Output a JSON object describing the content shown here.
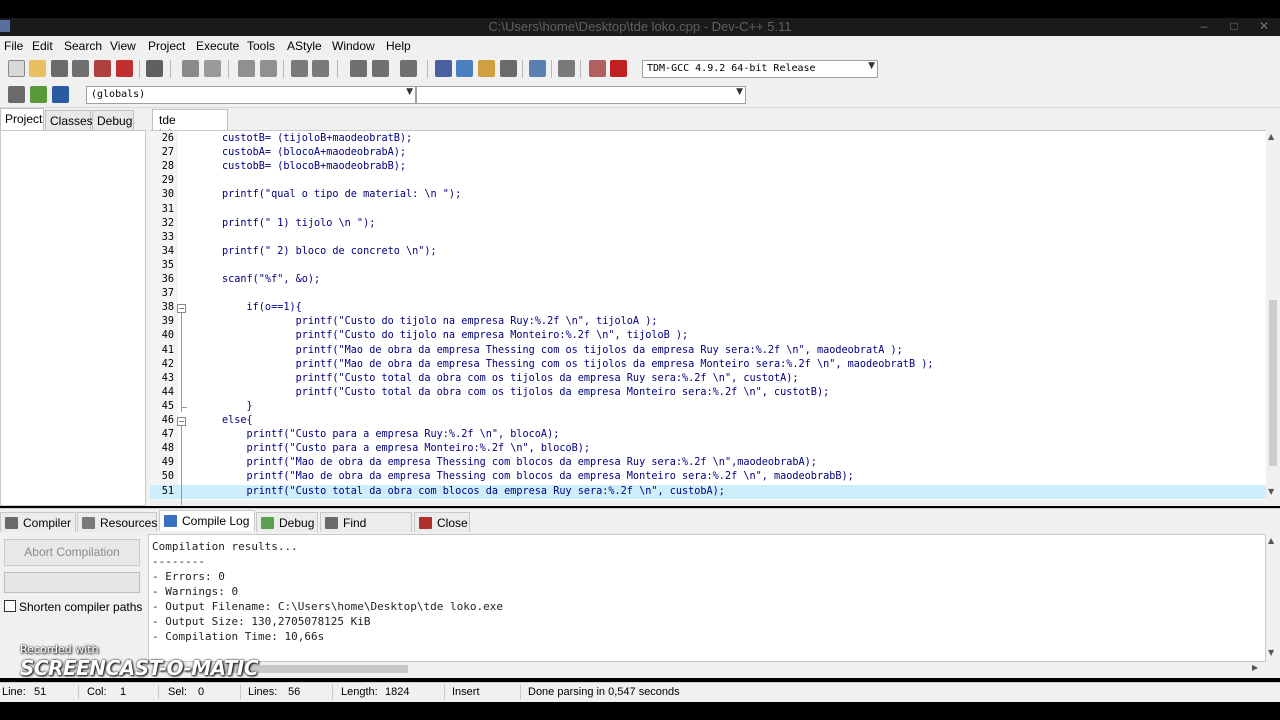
{
  "window": {
    "title": "C:\\Users\\home\\Desktop\\tde loko.cpp - Dev-C++ 5.11"
  },
  "menu": [
    "File",
    "Edit",
    "Search",
    "View",
    "Project",
    "Execute",
    "Tools",
    "AStyle",
    "Window",
    "Help"
  ],
  "toolbar": {
    "compiler_select": "TDM-GCC 4.9.2 64-bit Release",
    "scope_select": "(globals)",
    "function_select": ""
  },
  "left_tabs": [
    "Project",
    "Classes",
    "Debug"
  ],
  "editor": {
    "file_tab": "tde loko.cpp",
    "current_line": 51,
    "lines": [
      {
        "n": "26",
        "text": "custotB= (tijoloB+maodeobratB);"
      },
      {
        "n": "27",
        "text": "custobA= (blocoA+maodeobrabA);"
      },
      {
        "n": "28",
        "text": "custobB= (blocoB+maodeobrabB);"
      },
      {
        "n": "29",
        "text": ""
      },
      {
        "n": "30",
        "text": "printf(\"qual o tipo de material: \\n \");"
      },
      {
        "n": "31",
        "text": ""
      },
      {
        "n": "32",
        "text": "printf(\" 1) tijolo \\n \");"
      },
      {
        "n": "33",
        "text": ""
      },
      {
        "n": "34",
        "text": "printf(\" 2) bloco de concreto \\n\");"
      },
      {
        "n": "35",
        "text": ""
      },
      {
        "n": "36",
        "text": "scanf(\"%f\", &o);"
      },
      {
        "n": "37",
        "text": ""
      },
      {
        "n": "38",
        "text": "    if(o==1){"
      },
      {
        "n": "39",
        "text": "            printf(\"Custo do tijolo na empresa Ruy:%.2f \\n\", tijoloA );"
      },
      {
        "n": "40",
        "text": "            printf(\"Custo do tijolo na empresa Monteiro:%.2f \\n\", tijoloB );"
      },
      {
        "n": "41",
        "text": "            printf(\"Mao de obra da empresa Thessing com os tijolos da empresa Ruy sera:%.2f \\n\", maodeobratA );"
      },
      {
        "n": "42",
        "text": "            printf(\"Mao de obra da empresa Thessing com os tijolos da empresa Monteiro sera:%.2f \\n\", maodeobratB );"
      },
      {
        "n": "43",
        "text": "            printf(\"Custo total da obra com os tijolos da empresa Ruy sera:%.2f \\n\", custotA);"
      },
      {
        "n": "44",
        "text": "            printf(\"Custo total da obra com os tijolos da empresa Monteiro sera:%.2f \\n\", custotB);"
      },
      {
        "n": "45",
        "text": "    }"
      },
      {
        "n": "46",
        "text": "else{"
      },
      {
        "n": "47",
        "text": "    printf(\"Custo para a empresa Ruy:%.2f \\n\", blocoA);"
      },
      {
        "n": "48",
        "text": "    printf(\"Custo para a empresa Monteiro:%.2f \\n\", blocoB);"
      },
      {
        "n": "49",
        "text": "    printf(\"Mao de obra da empresa Thessing com blocos da empresa Ruy sera:%.2f \\n\",maodeobrabA);"
      },
      {
        "n": "50",
        "text": "    printf(\"Mao de obra da empresa Thessing com blocos da empresa Monteiro sera:%.2f \\n\", maodeobrabB);"
      },
      {
        "n": "51",
        "text": "    printf(\"Custo total da obra com blocos da empresa Ruy sera:%.2f \\n\", custobA);"
      }
    ]
  },
  "bottom_tabs": [
    "Compiler",
    "Resources",
    "Compile Log",
    "Debug",
    "Find Results",
    "Close"
  ],
  "compile": {
    "abort_label": "Abort Compilation",
    "shorten_label": "Shorten compiler paths",
    "log": [
      "Compilation results...",
      "--------",
      "- Errors: 0",
      "- Warnings: 0",
      "- Output Filename: C:\\Users\\home\\Desktop\\tde loko.exe",
      "- Output Size: 130,2705078125 KiB",
      "- Compilation Time: 10,66s"
    ]
  },
  "status": {
    "line_label": "Line:",
    "line_value": "51",
    "col_label": "Col:",
    "col_value": "1",
    "sel_label": "Sel:",
    "sel_value": "0",
    "lines_label": "Lines:",
    "lines_value": "56",
    "length_label": "Length:",
    "length_value": "1824",
    "mode": "Insert",
    "message": "Done parsing in 0,547 seconds"
  },
  "watermark": {
    "line1": "Recorded with",
    "line2": "SCREENCAST-O-MATIC"
  },
  "colors": {
    "code": "#000080",
    "current_line": "#cfeefc",
    "chrome": "#f0f0f0"
  }
}
